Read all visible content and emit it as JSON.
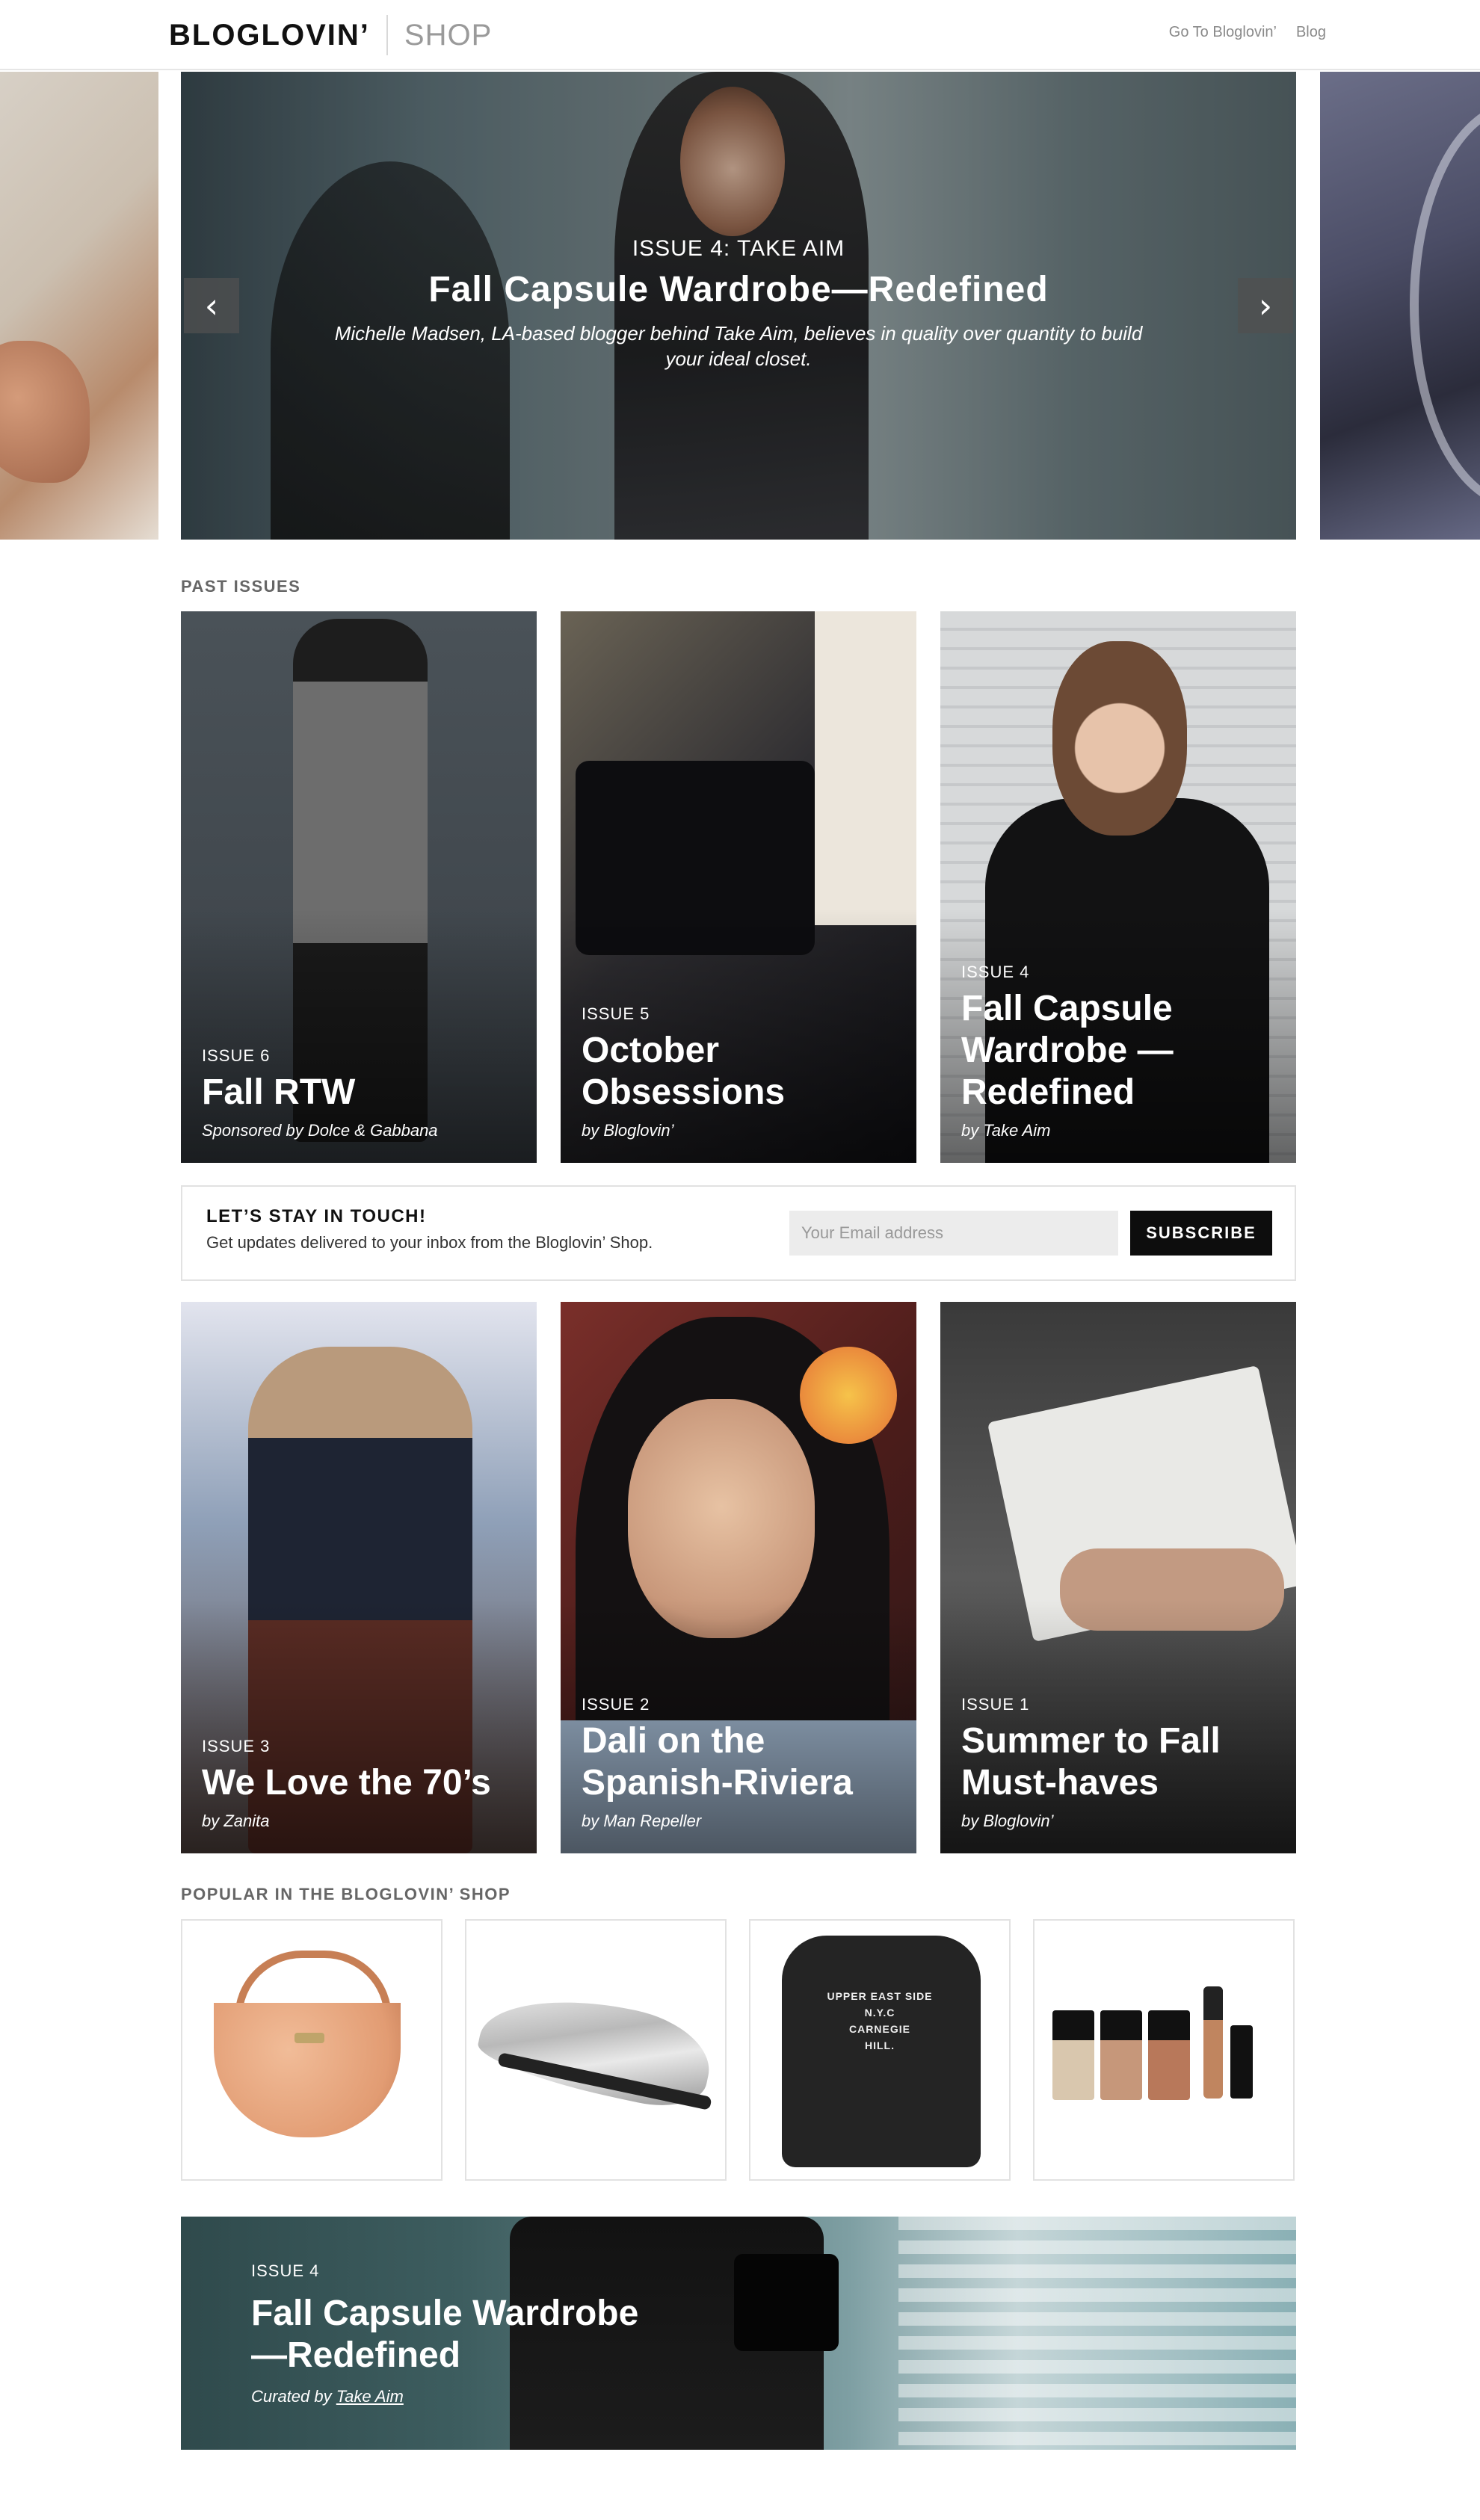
{
  "header": {
    "logo": "BLOGLOVIN’",
    "logo_sub": "SHOP",
    "nav": [
      "Go To Bloglovin’",
      "Blog"
    ]
  },
  "hero": {
    "kicker": "ISSUE 4: TAKE AIM",
    "title": "Fall Capsule Wardrobe—Redefined",
    "description": "Michelle Madsen, LA-based blogger behind Take Aim, believes in quality over quantity to build your ideal closet.",
    "prev_icon": "chevron-left-icon",
    "next_icon": "chevron-right-icon"
  },
  "past_issues": {
    "label": "PAST ISSUES",
    "cards": [
      {
        "issue": "ISSUE 6",
        "title": "Fall RTW",
        "by": "Sponsored by Dolce & Gabbana"
      },
      {
        "issue": "ISSUE 5",
        "title": "October Obsessions",
        "by": "by Bloglovin’"
      },
      {
        "issue": "ISSUE 4",
        "title": "Fall Capsule Wardrobe —Redefined",
        "by": "by Take Aim"
      },
      {
        "issue": "ISSUE 3",
        "title": "We Love the 70’s",
        "by": "by Zanita"
      },
      {
        "issue": "ISSUE 2",
        "title": "Dali on the Spanish-Riviera",
        "by": "by Man Repeller"
      },
      {
        "issue": "ISSUE 1",
        "title": "Summer to Fall Must-haves",
        "by": "by Bloglovin’"
      }
    ]
  },
  "newsletter": {
    "heading": "LET’S STAY IN TOUCH!",
    "text": "Get updates delivered to your inbox from the Bloglovin’ Shop.",
    "placeholder": "Your Email address",
    "button": "SUBSCRIBE"
  },
  "popular": {
    "label": "POPULAR IN THE BLOGLOVIN’ SHOP",
    "products": [
      {
        "name": "handbag"
      },
      {
        "name": "silver-loafer"
      },
      {
        "name": "sweatshirt",
        "print": [
          "UPPER EAST SIDE",
          "N.Y.C",
          "CARNEGIE",
          "HILL."
        ]
      },
      {
        "name": "nail-polish-set"
      }
    ]
  },
  "banner": {
    "issue": "ISSUE 4",
    "title_line1": "Fall Capsule Wardrobe",
    "title_line2": "—Redefined",
    "curated_prefix": "Curated by ",
    "curated_link": "Take Aim"
  }
}
